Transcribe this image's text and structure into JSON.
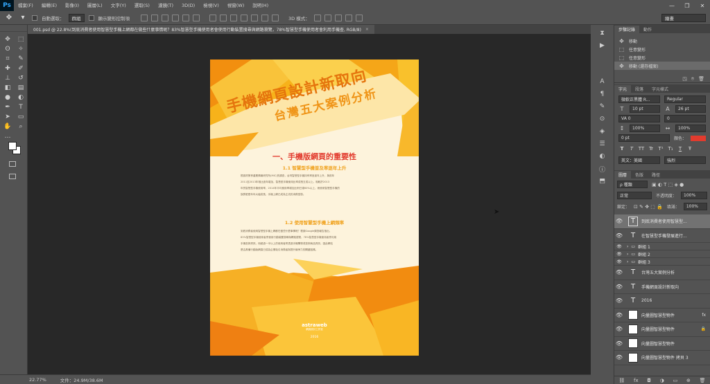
{
  "app": {
    "logo": "Ps",
    "title_bar_sel": "繪畫"
  },
  "menu": [
    "檔案(F)",
    "編輯(E)",
    "影像(I)",
    "圖層(L)",
    "文字(Y)",
    "選取(S)",
    "濾鏡(T)",
    "3D(D)",
    "檢視(V)",
    "視窗(W)",
    "說明(H)"
  ],
  "window_controls": [
    "—",
    "❐",
    "✕"
  ],
  "options": {
    "auto_select_label": "自動選取：",
    "auto_select_value": "群組",
    "show_transform_label": "顯示變形控制項",
    "mode3d_label": "3D 模式："
  },
  "doc_tab": {
    "title": "001.psd @ 22.8%(到底消費者使用智慧型手機上網都在做些什麼事情呢？83%智慧型手機使用者會使用行動裝置搜尋與網路瀏覽，78%智慧型手機使用者會利用手機查, RGB/8)",
    "close": "×"
  },
  "status": {
    "zoom": "22.77%",
    "docsize": "文件：24.9M/38.6M"
  },
  "poster": {
    "title1": "手機網頁設計新取向",
    "title2": "台灣五大案例分析",
    "section1": "一、手機版網頁的重要性",
    "sub1": "1.1 智慧型手機普及率逐年上升",
    "para1": [
      "根據資策會產業情報研究所(MIC)的調查，台灣智慧型手機持有率呈逐年上升，與前年",
      "2011至2013年相比逐年增加，智慧型手機使用比率成長五成以上。相較於2013",
      "年的智慧型手機使用率，2014年平均使用率增加比例已達60%以上，而使用智慧型手機的",
      "族群更是年年大幅成長，手機上網已成為主流的消費型態。"
    ],
    "sub2": "1.2 使用智慧型手機上網頻率",
    "para2": [
      "到底消費者使用智慧型手機上網都在做些什麼事情呢？根據Google調查報告指出，",
      "83%智慧型手機使用者會使用行動裝置搜尋與網路瀏覽，78%智慧型手機使用者會利用",
      "手機查詢資訊，而超過一半以上的使用者會透過手機購物或查詢商品資訊，因此網站",
      "是否具備行動版網頁已成為企業吸引消費者與提升競爭力的關鍵因素。"
    ],
    "brand": "astraweb",
    "brand_sub": "網頁設計工作室",
    "year": "2016"
  },
  "history": {
    "tabs": [
      "步驟記錄",
      "動作"
    ],
    "rows": [
      "移動",
      "任意變形",
      "任意變形",
      "移動 (還存檔案)"
    ]
  },
  "character": {
    "tabs": [
      "字元",
      "段落",
      "字元樣式"
    ],
    "font": "微軟正黑體 R...",
    "style": "Regular",
    "size": "10 pt",
    "leading": "26 pt",
    "kerning": "VA 0",
    "tracking": "0",
    "vscale": "100%",
    "hscale": "100%",
    "baseline": "0 pt",
    "color_label": "顏色：",
    "lang": "英文：美國",
    "aa": "強烈",
    "fmt": [
      "T",
      "T",
      "TT",
      "Tr",
      "T¹",
      "T₁",
      "T",
      "Ŧ"
    ]
  },
  "layers": {
    "tabs": [
      "圖層",
      "色版",
      "路徑"
    ],
    "filter": "ρ 種類",
    "blend": "正常",
    "opacity_label": "不透明度：",
    "opacity": "100%",
    "lock_label": "鎖定：",
    "fill_label": "填滿：",
    "fill": "100%",
    "items": [
      {
        "type": "text",
        "name": "到底消費者使用智慧型...",
        "selected": true
      },
      {
        "type": "text",
        "name": "在智慧型手機發展進行..."
      },
      {
        "type": "folder",
        "name": "群組 1"
      },
      {
        "type": "folder",
        "name": "群組 2"
      },
      {
        "type": "folder",
        "name": "群組 3"
      },
      {
        "type": "text",
        "name": "台灣五大案例分析"
      },
      {
        "type": "text",
        "name": "手機網頁設計新取向"
      },
      {
        "type": "text",
        "name": "2016"
      },
      {
        "type": "img",
        "name": "向量圖智慧型物件",
        "extra": "fx"
      },
      {
        "type": "img",
        "name": "向量圖智慧型物件",
        "extra": "🔒"
      },
      {
        "type": "img",
        "name": "向量圖智慧型物件"
      },
      {
        "type": "img",
        "name": "向量圖智慧型物件 拷貝 3"
      }
    ],
    "footer": [
      "⛓",
      "fx",
      "◘",
      "◑",
      "▭",
      "⊕",
      "🗑"
    ]
  },
  "colors": {
    "poster_bg": "#fdf3dc",
    "orange": "#f29b16",
    "red_heading": "#e23b2e",
    "subhead": "#f0a11c"
  }
}
